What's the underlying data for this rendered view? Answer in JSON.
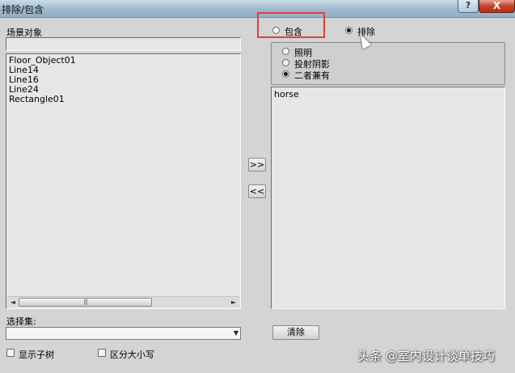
{
  "window": {
    "title": "排除/包含",
    "help_glyph": "?",
    "close_glyph": "X"
  },
  "left": {
    "scene_objects_label": "场景对象",
    "search_value": "",
    "objects": [
      "Floor_Object01",
      "Line14",
      "Line16",
      "Line24",
      "Rectangle01"
    ],
    "scroll_left_glyph": "◄",
    "scroll_right_glyph": "►",
    "scroll_thumb_grip": "|||",
    "selection_set_label": "选择集:",
    "selection_set_value": "",
    "combo_arrow": "▼",
    "show_subtree_label": "显示子树",
    "case_sensitive_label": "区分大小写"
  },
  "middle": {
    "add_label": ">>",
    "remove_label": "<<"
  },
  "right": {
    "mode_include_label": "包含",
    "mode_exclude_label": "排除",
    "mode_selected": "exclude",
    "type_options": [
      "照明",
      "投射阴影",
      "二者兼有"
    ],
    "type_selected": 2,
    "objects": [
      "horse"
    ],
    "clear_label": "清除"
  },
  "overlay": {
    "watermark": "头条 @室内设计谈单技巧",
    "highlight_color": "#e0403a"
  }
}
